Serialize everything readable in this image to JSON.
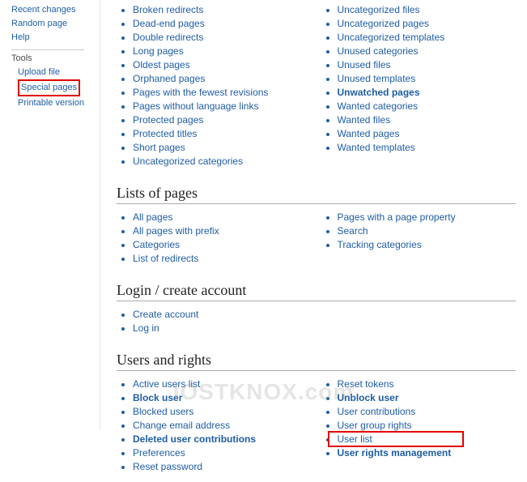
{
  "sidebar": {
    "nav": [
      {
        "label": "Recent changes"
      },
      {
        "label": "Random page"
      },
      {
        "label": "Help"
      }
    ],
    "tools_heading": "Tools",
    "tools": [
      {
        "label": "Upload file",
        "highlight": false
      },
      {
        "label": "Special pages",
        "highlight": true
      },
      {
        "label": "Printable version",
        "highlight": false
      }
    ]
  },
  "sections": {
    "top": {
      "left": [
        {
          "label": "Broken redirects"
        },
        {
          "label": "Dead-end pages"
        },
        {
          "label": "Double redirects"
        },
        {
          "label": "Long pages"
        },
        {
          "label": "Oldest pages"
        },
        {
          "label": "Orphaned pages"
        },
        {
          "label": "Pages with the fewest revisions"
        },
        {
          "label": "Pages without language links"
        },
        {
          "label": "Protected pages"
        },
        {
          "label": "Protected titles"
        },
        {
          "label": "Short pages"
        },
        {
          "label": "Uncategorized categories"
        }
      ],
      "right": [
        {
          "label": "Uncategorized files"
        },
        {
          "label": "Uncategorized pages"
        },
        {
          "label": "Uncategorized templates"
        },
        {
          "label": "Unused categories"
        },
        {
          "label": "Unused files"
        },
        {
          "label": "Unused templates"
        },
        {
          "label": "Unwatched pages",
          "bold": true
        },
        {
          "label": "Wanted categories"
        },
        {
          "label": "Wanted files"
        },
        {
          "label": "Wanted pages"
        },
        {
          "label": "Wanted templates"
        }
      ]
    },
    "lists_of_pages": {
      "title": "Lists of pages",
      "left": [
        {
          "label": "All pages"
        },
        {
          "label": "All pages with prefix"
        },
        {
          "label": "Categories"
        },
        {
          "label": "List of redirects"
        }
      ],
      "right": [
        {
          "label": "Pages with a page property"
        },
        {
          "label": "Search"
        },
        {
          "label": "Tracking categories"
        }
      ]
    },
    "login": {
      "title": "Login / create account",
      "left": [
        {
          "label": "Create account"
        },
        {
          "label": "Log in"
        }
      ]
    },
    "users_rights": {
      "title": "Users and rights",
      "left": [
        {
          "label": "Active users list"
        },
        {
          "label": "Block user",
          "bold": true
        },
        {
          "label": "Blocked users"
        },
        {
          "label": "Change email address"
        },
        {
          "label": "Deleted user contributions",
          "bold": true
        },
        {
          "label": "Preferences"
        },
        {
          "label": "Reset password"
        }
      ],
      "right": [
        {
          "label": "Reset tokens"
        },
        {
          "label": "Unblock user",
          "bold": true
        },
        {
          "label": "User contributions"
        },
        {
          "label": "User group rights"
        },
        {
          "label": "User list",
          "highlight": true
        },
        {
          "label": "User rights management",
          "bold": true
        }
      ]
    }
  },
  "watermark": "IOSTKNOX.com"
}
